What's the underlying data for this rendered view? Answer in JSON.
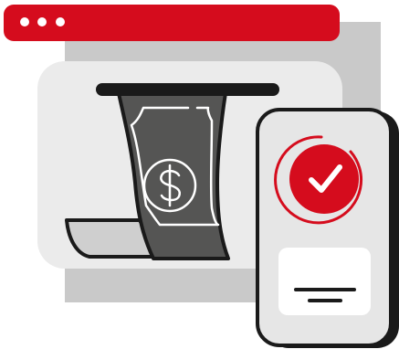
{
  "illustration": {
    "window_dots": 3,
    "icons": {
      "cash": "dollar-sign-icon",
      "status": "checkmark-icon"
    }
  },
  "colors": {
    "accent": "#d50c1d",
    "dark": "#1a1a1a",
    "bill": "#555554",
    "bill_slot": "#e9e9e9",
    "shadow_gray": "#c8c8c8",
    "light_gray": "#e6e6e6",
    "card": "#ffffff"
  }
}
